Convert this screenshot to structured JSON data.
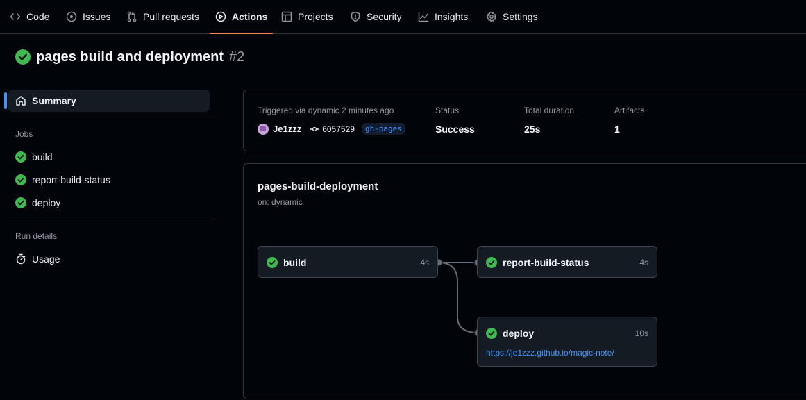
{
  "nav": {
    "tabs": [
      {
        "label": "Code",
        "icon": "code-icon"
      },
      {
        "label": "Issues",
        "icon": "issue-opened-icon"
      },
      {
        "label": "Pull requests",
        "icon": "git-pull-request-icon"
      },
      {
        "label": "Actions",
        "icon": "play-icon",
        "active": true
      },
      {
        "label": "Projects",
        "icon": "table-icon"
      },
      {
        "label": "Security",
        "icon": "shield-icon"
      },
      {
        "label": "Insights",
        "icon": "graph-icon"
      },
      {
        "label": "Settings",
        "icon": "gear-icon"
      }
    ]
  },
  "run": {
    "title": "pages build and deployment",
    "number": "#2",
    "status_color": "#3fb950"
  },
  "sidebar": {
    "summary_label": "Summary",
    "jobs_heading": "Jobs",
    "jobs": [
      {
        "label": "build"
      },
      {
        "label": "report-build-status"
      },
      {
        "label": "deploy"
      }
    ],
    "run_details_heading": "Run details",
    "usage_label": "Usage"
  },
  "summary": {
    "trigger_label": "Triggered via dynamic 2 minutes ago",
    "user": "Je1zzz",
    "commit": "6057529",
    "branch": "gh-pages",
    "status_label": "Status",
    "status_value": "Success",
    "duration_label": "Total duration",
    "duration_value": "25s",
    "artifacts_label": "Artifacts",
    "artifacts_value": "1"
  },
  "workflow": {
    "name": "pages-build-deployment",
    "on": "on: dynamic",
    "jobs": [
      {
        "name": "build",
        "duration": "4s"
      },
      {
        "name": "report-build-status",
        "duration": "4s"
      },
      {
        "name": "deploy",
        "duration": "10s",
        "url": "https://je1zzz.github.io/magic-note/"
      }
    ]
  },
  "colors": {
    "accent": "#4493f8",
    "active_tab_underline": "#f78166",
    "success": "#3fb950"
  }
}
